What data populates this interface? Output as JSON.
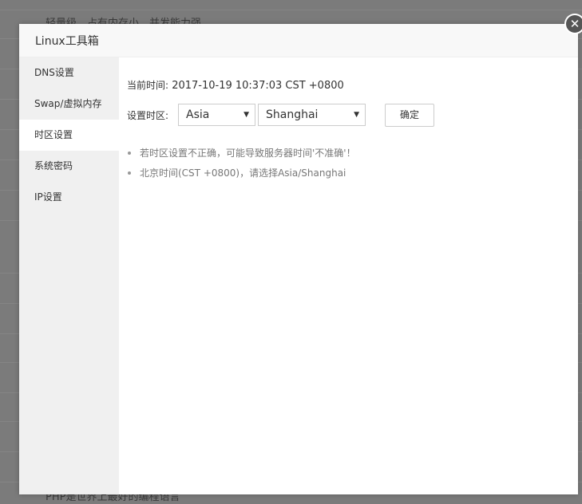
{
  "background": {
    "top_text": "轻量级，占有内存小，并发能力强",
    "bottom_text": "PHP是世界上最好的编程语言"
  },
  "dialog": {
    "title": "Linux工具箱",
    "close_icon": "close-icon"
  },
  "sidebar": {
    "items": [
      {
        "label": "DNS设置",
        "active": false
      },
      {
        "label": "Swap/虚拟内存",
        "active": false
      },
      {
        "label": "时区设置",
        "active": true
      },
      {
        "label": "系统密码",
        "active": false
      },
      {
        "label": "IP设置",
        "active": false
      }
    ]
  },
  "timezone": {
    "current_time_label": "当前时间:",
    "current_time_value": "2017-10-19 10:37:03 CST +0800",
    "set_label": "设置时区:",
    "region_selected": "Asia",
    "city_selected": "Shanghai",
    "confirm_label": "确定",
    "notes": [
      "若时区设置不正确，可能导致服务器时间'不准确'！",
      "北京时间(CST +0800)，请选择Asia/Shanghai"
    ]
  }
}
